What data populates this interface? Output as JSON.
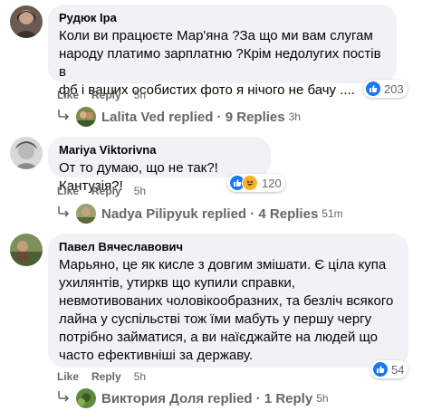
{
  "comments": [
    {
      "author": "Рудюк Іра",
      "lines": [
        "Коли ви працюєте Мар'яна ?За що ми вам слугам",
        "народу платимо зарплатню ?Крім недолугих постів в",
        "фб і ваших особистих фото я нічого не бачу ...."
      ],
      "like_label": "Like",
      "reply_label": "Reply",
      "time": "5h",
      "reaction_count": "203",
      "replies": {
        "name": "Lalita Ved",
        "action": "replied",
        "count_text": "9 Replies",
        "time": "3h"
      }
    },
    {
      "author": "Mariya Viktorivna",
      "lines": [
        "От то думаю, що не так?! Кантузія?!"
      ],
      "like_label": "Like",
      "reply_label": "Reply",
      "time": "5h",
      "reaction_count": "120",
      "replies": {
        "name": "Nadya Pilipyuk",
        "action": "replied",
        "count_text": "4 Replies",
        "time": "51m"
      }
    },
    {
      "author": "Павел Вячеславович",
      "lines": [
        "Марьяно, це як кисле з довгим змішати. Є ціла купа",
        "ухилянтів, утиркв що купили справки,",
        "невмотивованих чоловікообразних, та безліч всякого",
        "лайна у суспільстві тож їми мабуть у першу чергу",
        "потрібно займатися, а ви наїєджайте на людей що",
        "часто ефективніші за державу."
      ],
      "like_label": "Like",
      "reply_label": "Reply",
      "time": "5h",
      "reaction_count": "54",
      "replies": {
        "name": "Виктория Доля",
        "action": "replied",
        "count_text": "1 Reply",
        "time": "5h"
      }
    }
  ],
  "colors": {
    "bubble": "#f0f2f5",
    "meta": "#65676b",
    "like": "#1877f2",
    "haha": "#f7b125"
  },
  "icons": [
    "reply-arrow-icon",
    "like-reaction-icon",
    "haha-reaction-icon"
  ]
}
